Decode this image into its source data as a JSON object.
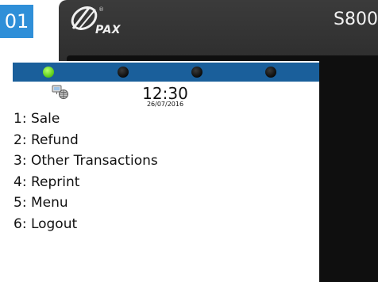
{
  "step_badge": "01",
  "device": {
    "brand": "PAX",
    "model": "S800"
  },
  "status_leds": [
    {
      "state": "on",
      "color": "#63d11f"
    },
    {
      "state": "off",
      "color": "#111111"
    },
    {
      "state": "off",
      "color": "#111111"
    },
    {
      "state": "off",
      "color": "#111111"
    }
  ],
  "screen": {
    "network_icon": "network-globe-icon",
    "time": "12:30",
    "date": "26/07/2016",
    "menu_items": [
      "1: Sale",
      "2: Refund",
      "3: Other Transactions",
      "4: Reprint",
      "5: Menu",
      "6: Logout"
    ]
  },
  "colors": {
    "badge": "#2f8fd8",
    "status_bar": "#1a5f9b",
    "device_body": "#262626"
  }
}
